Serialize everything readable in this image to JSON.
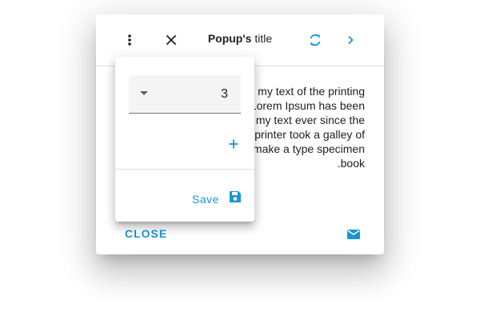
{
  "colors": {
    "accent": "#1a95d4",
    "text": "#212121",
    "divider": "#e0e0e0",
    "field_bg": "#f5f5f5"
  },
  "dialog": {
    "title_bold": "Popup's",
    "title_rest": " title",
    "body_lines": [
      "my text of the printing",
      "Lorem Ipsum has been",
      "my text ever since the",
      "printer took a galley of",
      "make a type specimen",
      ".book"
    ],
    "close_label": "CLOSE",
    "icons": {
      "menu": "more-vert-icon",
      "close": "close-icon",
      "refresh": "refresh-icon",
      "next": "chevron-right-icon",
      "mail": "mail-icon"
    }
  },
  "popover": {
    "select_value": "3",
    "save_label": "Save",
    "icons": {
      "dropdown": "dropdown-arrow-icon",
      "add": "plus-icon",
      "save": "floppy-disk-icon"
    }
  }
}
